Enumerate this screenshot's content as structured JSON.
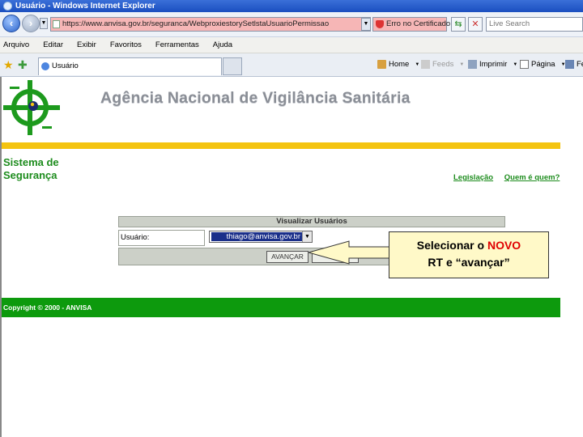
{
  "window": {
    "title": "Usuário - Windows Internet Explorer"
  },
  "address_bar": {
    "url": "https://www.anvisa.gov.br/seguranca/WebproxiestorySetlstaUsuarioPermissao",
    "cert_label": "Erro no Certificado",
    "search_placeholder": "Live Search"
  },
  "menu": {
    "items": [
      "Arquivo",
      "Editar",
      "Exibir",
      "Favoritos",
      "Ferramentas",
      "Ajuda"
    ]
  },
  "tabs": [
    {
      "label": "Usuário"
    }
  ],
  "command_bar": {
    "home": "Home",
    "feeds": "Feeds",
    "print": "Imprimir",
    "page": "Página",
    "tools": "Fe"
  },
  "page": {
    "agency_title": "Agência Nacional de Vigilância Sanitária",
    "system_title_line1": "Sistema de",
    "system_title_line2": "Segurança",
    "links": [
      "Legislação",
      "Quem é quem?"
    ],
    "form": {
      "header": "Visualizar Usuários",
      "field_label": "Usuário:",
      "selected_user": "thiago@anvisa.gov.br",
      "button_label": "AVANÇAR"
    },
    "footer": "Copyright © 2000 - ANVISA"
  },
  "callout": {
    "line1_prefix": "Selecionar o ",
    "line1_highlight": "NOVO",
    "line2": "RT e “avançar”"
  },
  "colors": {
    "brand_green": "#0d9a0d",
    "accent_yellow": "#f4c410",
    "highlight_red": "#e00000"
  }
}
